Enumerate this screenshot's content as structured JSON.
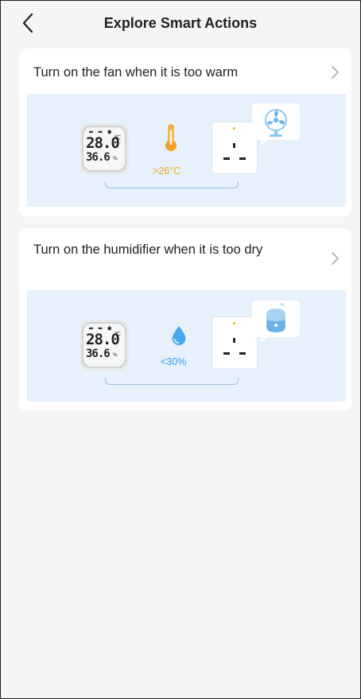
{
  "header": {
    "title": "Explore Smart Actions"
  },
  "actions": [
    {
      "title": "Turn on the fan when it is too warm",
      "sensor": {
        "temperature": "28.0",
        "temperature_unit": "℃",
        "humidity": "36.6",
        "humidity_unit": "%"
      },
      "condition": ">26°C",
      "condition_color": "#f0a522",
      "device": "fan"
    },
    {
      "title": "Turn on the humidifier when it is too dry",
      "sensor": {
        "temperature": "28.0",
        "temperature_unit": "℃",
        "humidity": "36.6",
        "humidity_unit": "%"
      },
      "condition": "<30%",
      "condition_color": "#3e9be6",
      "device": "humidifier"
    }
  ]
}
